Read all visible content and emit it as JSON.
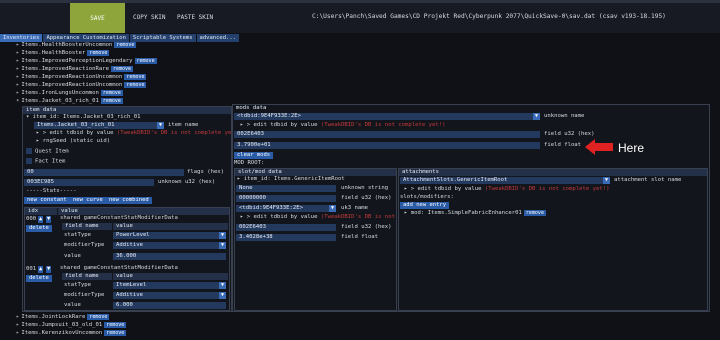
{
  "toolbar": {
    "save": "SAVE",
    "copy_skin": "COPY SKIN",
    "paste_skin": "PASTE SKIN",
    "path": "C:\\Users\\Panch\\Saved Games\\CD Projekt Red\\Cyberpunk 2077\\QuickSave-0\\sav.dat (csav v193-18.195)"
  },
  "tabs": [
    "Inventories",
    "Appearance Customization",
    "Scriptable Systems",
    "advanced..."
  ],
  "tree_top": [
    "Items.HealthBoosterUncommon",
    "Items.HealthBooster",
    "Items.ImprovedPerceptionLegendary",
    "Items.ImprovedReactionRare",
    "Items.ImprovedReactionUncommon",
    "Items.ImprovedReactionUncommon",
    "Items.IronLungsUncommon",
    "Items.Jacket_03_rich_01"
  ],
  "remove": "remove",
  "item_data": {
    "header": "item data",
    "item_id": "item_id: Items.Jacket_03_rich_01",
    "item_name_value": "Items.Jacket_03_rich_01",
    "item_name_label": "item name",
    "edit_tdbid": "> edit tdbid by value",
    "warn": "(TweakDBID's DB is not complete yet!)",
    "rng_seed": "rngSeed (static uid)",
    "quest_item": "Quest Item",
    "fact_item": "Fact Item",
    "flags_value": "00",
    "flags_label": "flags (hex)",
    "unknown_value": "003EC985",
    "unknown_label": "unknown u32 (hex)",
    "stats_title": "-----Stats-----",
    "new_constant": "new constant",
    "new_curve": "new curve",
    "new_combined": "new combined",
    "col_idx": "idx",
    "col_value": "value",
    "delete": "delete",
    "stats": [
      {
        "idx": "000",
        "title": "shared gameConstantStatModifierData",
        "stat_type": "PowerLevel",
        "modifier_type": "Additive",
        "value": "36.000"
      },
      {
        "idx": "001",
        "title": "shared gameConstantStatModifierData",
        "stat_type": "ItemLevel",
        "modifier_type": "Additive",
        "value": "6.000"
      }
    ],
    "field_name": "field name",
    "field_value": "value",
    "stat_type_label": "statType",
    "modifier_type_label": "modifierType",
    "value_label": "value"
  },
  "mods_data": {
    "header": "mods data",
    "tdbid": "<tdbid:9E4F933E:2E>",
    "unknown_name": "unknown name",
    "u32_value": "002E6403",
    "u32_label": "field u32 (hex)",
    "float_value": "3.7900e+01",
    "float_label": "field float",
    "clear_mods": "clear mods",
    "mod_root": "MOD ROOT:",
    "annotation": "Here"
  },
  "slot_data": {
    "header": "slot/mod data",
    "item_id": "item_id: Items.GenericItemRoot",
    "unknown_string_value": "None",
    "unknown_string_label": "unknown string",
    "u32a_value": "00000000",
    "u32a_label": "field u32 (hex)",
    "tdbid": "<tdbid:9E4F933E:2E>",
    "uk3": "uk3 name",
    "u32b_value": "002E6403",
    "u32b_label": "field u32 (hex)",
    "float_value": "3.4028e+38",
    "float_label": "field float"
  },
  "attachments": {
    "header": "attachments",
    "slot_value": "AttachmentSlots.GenericItemRoot",
    "slot_label": "attachment slot name",
    "slots_mods": "slots/modifiers:",
    "add_new": "add new entry",
    "mod": "mod: Items.SimpleFabricEnhancer01"
  },
  "tree_bottom": [
    "Items.JointLockRare",
    "Items.Jumpsuit_03_old_01",
    "Items.KerenzikovUncommon"
  ],
  "colors": {
    "accent": "#2a5ba7",
    "save": "#8da53a",
    "warning": "#c43a3a",
    "arrow": "#e02222"
  }
}
